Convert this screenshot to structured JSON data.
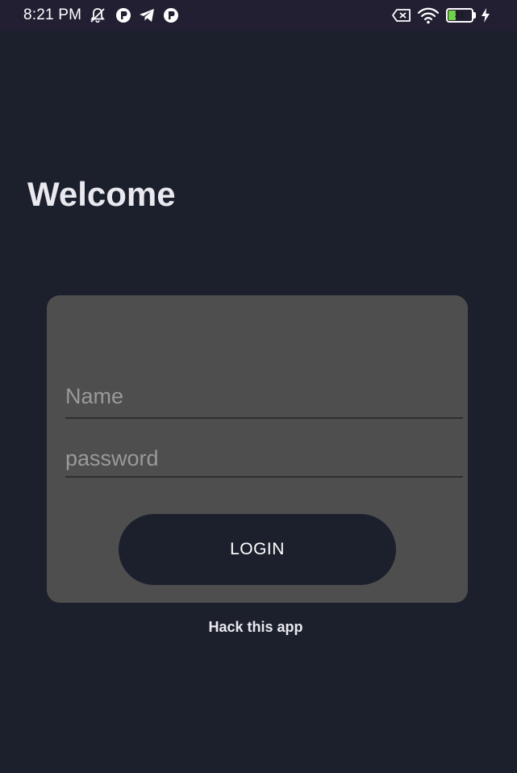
{
  "status_bar": {
    "time": "8:21 PM",
    "icons": [
      "muted-bell-icon",
      "app-notification-icon",
      "telegram-icon",
      "app-notification-icon",
      "no-sim-icon",
      "wifi-icon",
      "battery-icon",
      "charging-bolt-icon"
    ],
    "battery_level": "31",
    "battery_fraction": 0.31,
    "battery_color": "#6fd144"
  },
  "main": {
    "title": "Welcome"
  },
  "login_form": {
    "name_placeholder": "Name",
    "name_value": "",
    "password_placeholder": "password",
    "password_value": "",
    "login_label": "LOGIN"
  },
  "footer": {
    "hack_label": "Hack this app"
  },
  "colors": {
    "background": "#1c202c",
    "status_bar": "#221f33",
    "card": "#4e4e4e",
    "text": "#e9e9ef"
  }
}
